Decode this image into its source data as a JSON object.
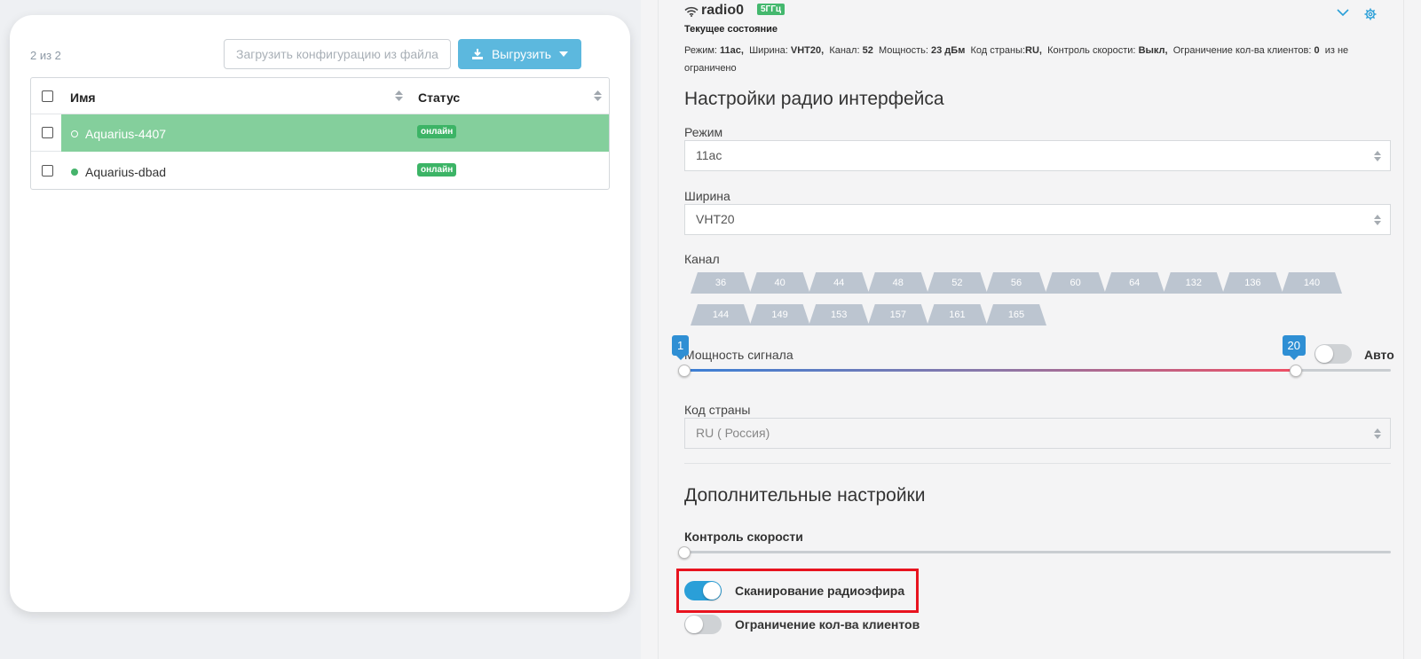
{
  "left": {
    "counter": "2 из 2",
    "load_button": "Загрузить конфигурацию из файла",
    "export_button": "Выгрузить",
    "columns": {
      "name": "Имя",
      "status": "Статус"
    },
    "rows": [
      {
        "name": "Aquarius-4407",
        "status": "онлайн",
        "selected": true
      },
      {
        "name": "Aquarius-dbad",
        "status": "онлайн",
        "selected": false
      }
    ]
  },
  "right": {
    "radio_name": "radio0",
    "band": "5ГГц",
    "current_state_label": "Текущее состояние",
    "state": {
      "mode_label": "Режим:",
      "mode_value": "11ac,",
      "width_label": "Ширина:",
      "width_value": "VHT20,",
      "channel_label": "Канал:",
      "channel_value": "52",
      "power_label": "Мощность:",
      "power_value": "23 дБм",
      "country_label": "Код страны:",
      "country_value": "RU,",
      "speed_label": "Контроль скорости:",
      "speed_value": "Выкл,",
      "clients_label": "Ограничение кол-ва клиентов:",
      "clients_value": "0",
      "clients_suffix": "из не ограничено"
    },
    "radio_settings_title": "Настройки радио интерфейса",
    "mode": {
      "label": "Режим",
      "value": "11ac"
    },
    "width": {
      "label": "Ширина",
      "value": "VHT20"
    },
    "channel_label": "Канал",
    "channels": [
      "36",
      "40",
      "44",
      "48",
      "52",
      "56",
      "60",
      "64",
      "132",
      "136",
      "140",
      "144",
      "149",
      "153",
      "157",
      "161",
      "165"
    ],
    "signal_power": {
      "label": "Мощность сигнала",
      "min_value": "1",
      "current_value": "20",
      "auto_label": "Авто",
      "fill_fraction": 0.865
    },
    "country": {
      "label": "Код страны",
      "value": "RU ( Россия)"
    },
    "additional_title": "Дополнительные настройки",
    "speed_control_label": "Контроль скорости",
    "scan_label": "Сканирование радиоэфира",
    "scan_enabled": true,
    "client_limit_label": "Ограничение кол-ва клиентов",
    "client_limit_enabled": false
  },
  "colors": {
    "accent": "#2a9fd8",
    "online": "#3cb466",
    "highlight_row": "#84cf9c",
    "red_highlight": "#e8131f"
  }
}
